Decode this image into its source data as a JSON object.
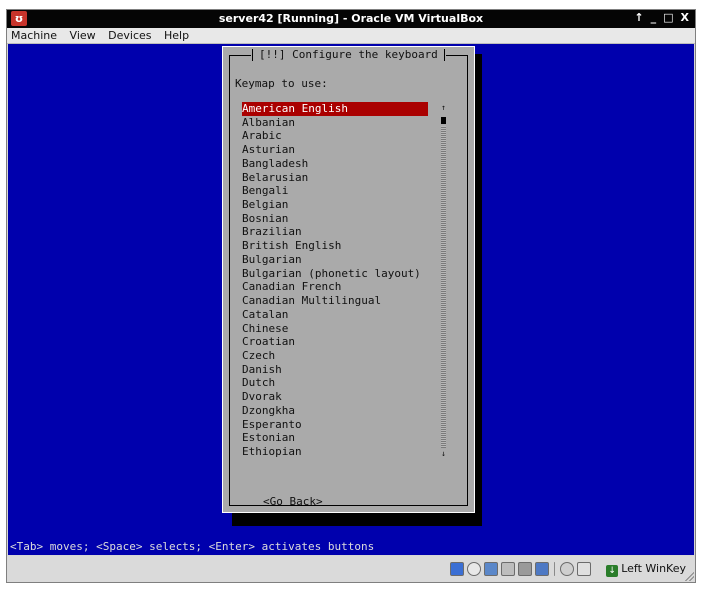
{
  "window": {
    "title": "server42 [Running] - Oracle VM VirtualBox",
    "controls": {
      "up": "↑",
      "minimize": "_",
      "maximize": "□",
      "close": "X"
    }
  },
  "menubar": {
    "items": [
      {
        "label": "Machine"
      },
      {
        "label": "View"
      },
      {
        "label": "Devices"
      },
      {
        "label": "Help"
      }
    ]
  },
  "dialog": {
    "title": "[!!] Configure the keyboard",
    "prompt": "Keymap to use:",
    "items": [
      {
        "label": "American English"
      },
      {
        "label": "Albanian"
      },
      {
        "label": "Arabic"
      },
      {
        "label": "Asturian"
      },
      {
        "label": "Bangladesh"
      },
      {
        "label": "Belarusian"
      },
      {
        "label": "Bengali"
      },
      {
        "label": "Belgian"
      },
      {
        "label": "Bosnian"
      },
      {
        "label": "Brazilian"
      },
      {
        "label": "British English"
      },
      {
        "label": "Bulgarian"
      },
      {
        "label": "Bulgarian (phonetic layout)"
      },
      {
        "label": "Canadian French"
      },
      {
        "label": "Canadian Multilingual"
      },
      {
        "label": "Catalan"
      },
      {
        "label": "Chinese"
      },
      {
        "label": "Croatian"
      },
      {
        "label": "Czech"
      },
      {
        "label": "Danish"
      },
      {
        "label": "Dutch"
      },
      {
        "label": "Dvorak"
      },
      {
        "label": "Dzongkha"
      },
      {
        "label": "Esperanto"
      },
      {
        "label": "Estonian"
      },
      {
        "label": "Ethiopian"
      }
    ],
    "selected_index": 0,
    "scroll_up": "↑",
    "scroll_down": "↓",
    "go_back_label": "<Go Back>"
  },
  "status_line": "<Tab> moves; <Space> selects; <Enter> activates buttons",
  "hostbar": {
    "icons": [
      "hard-disk-icon",
      "optical-drive-icon",
      "network-icon",
      "usb-icon",
      "shared-folders-icon",
      "display-icon",
      "video-capture-icon",
      "mouse-integration-icon",
      "host-key-icon"
    ],
    "host_key_label": "Left WinKey"
  },
  "colors": {
    "screen": "#0000ad",
    "dialog": "#aaaaaa",
    "selection": "#aa0000",
    "title_text": "#aa0000"
  }
}
